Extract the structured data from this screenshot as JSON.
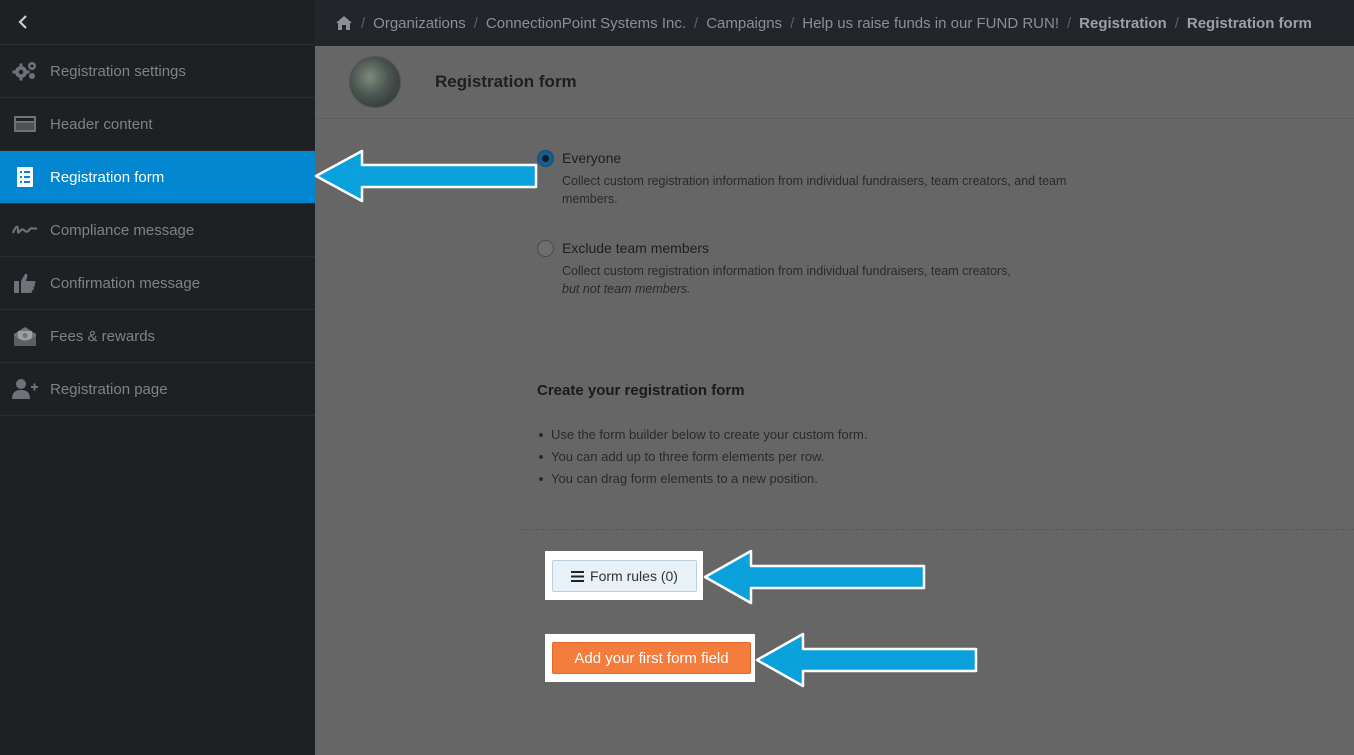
{
  "sidebar": {
    "back_icon": "chevron-left-icon",
    "items": [
      {
        "label": "Registration settings",
        "icon": "gears-icon"
      },
      {
        "label": "Header content",
        "icon": "window-icon"
      },
      {
        "label": "Registration form",
        "icon": "checklist-icon",
        "active": true
      },
      {
        "label": "Compliance message",
        "icon": "signature-icon"
      },
      {
        "label": "Confirmation message",
        "icon": "thumbs-up-icon"
      },
      {
        "label": "Fees & rewards",
        "icon": "money-envelope-icon"
      },
      {
        "label": "Registration page",
        "icon": "user-plus-icon"
      }
    ]
  },
  "breadcrumb": {
    "home_icon": "home-icon",
    "items": [
      "Organizations",
      "ConnectionPoint Systems Inc.",
      "Campaigns",
      "Help us raise funds in our FUND RUN!",
      "Registration",
      "Registration form"
    ]
  },
  "page": {
    "title": "Registration form"
  },
  "options": {
    "everyone": {
      "label": "Everyone",
      "desc": "Collect custom registration information from individual fundraisers, team creators, and team members.",
      "selected": true
    },
    "exclude": {
      "label": "Exclude team members",
      "desc": "Collect custom registration information from individual fundraisers, team creators,",
      "desc_italic": "but not team members.",
      "selected": false
    }
  },
  "builder": {
    "title": "Create your registration form",
    "bullets": [
      "Use the form builder below to create your custom form.",
      "You can add up to three form elements per row.",
      "You can drag form elements to a new position."
    ],
    "rules_button": "Form rules (0)",
    "add_button": "Add your first form field"
  },
  "colors": {
    "active": "#0286cf",
    "arrow": "#0aa0dc",
    "add_button": "#f47c3c",
    "sidebar_bg": "#1e2124"
  }
}
